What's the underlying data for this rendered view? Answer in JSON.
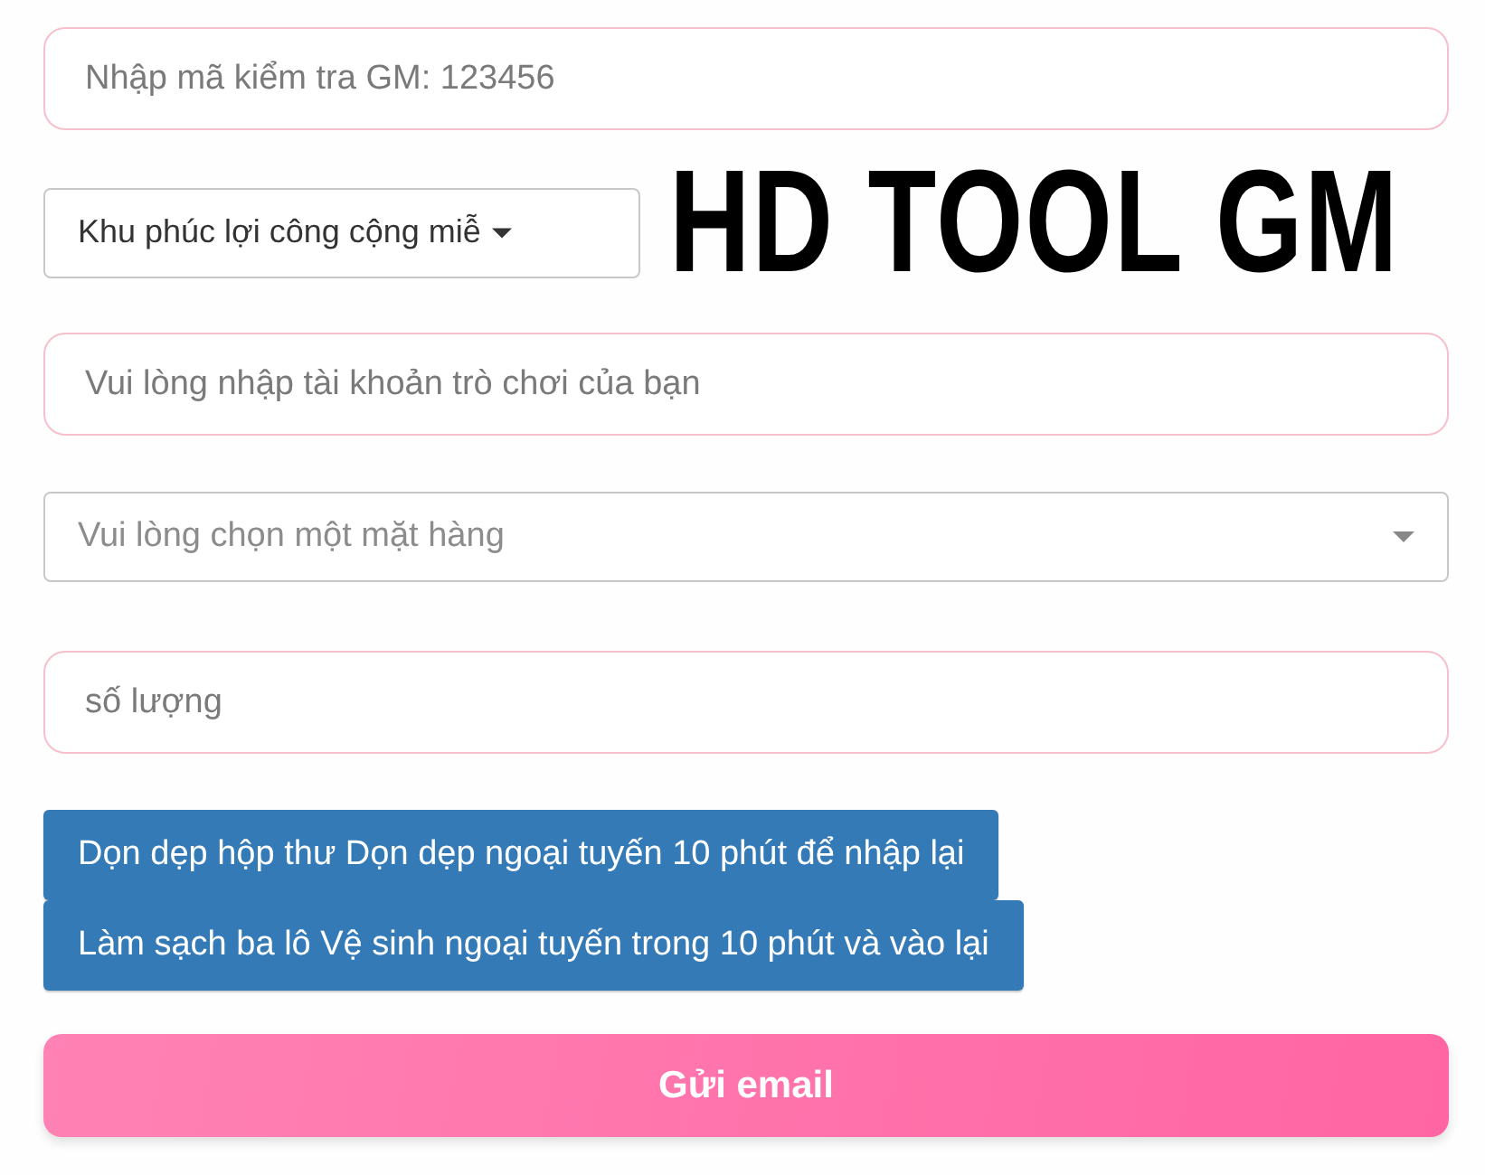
{
  "gm_code_field": {
    "placeholder": "Nhập mã kiểm tra GM: 123456"
  },
  "region_dropdown": {
    "label": "Khu phúc lợi công cộng miễ"
  },
  "title": "HD TOOL GM",
  "account_field": {
    "placeholder": "Vui lòng nhập tài khoản trò chơi của bạn"
  },
  "item_select": {
    "placeholder": "Vui lòng chọn một mặt hàng"
  },
  "quantity_field": {
    "placeholder": "số lượng"
  },
  "action_buttons": [
    "Dọn dẹp hộp thư Dọn dẹp ngoại tuyến 10 phút để nhập lại",
    "Làm sạch ba lô Vệ sinh ngoại tuyến trong 10 phút và vào lại"
  ],
  "submit_button": "Gửi email"
}
